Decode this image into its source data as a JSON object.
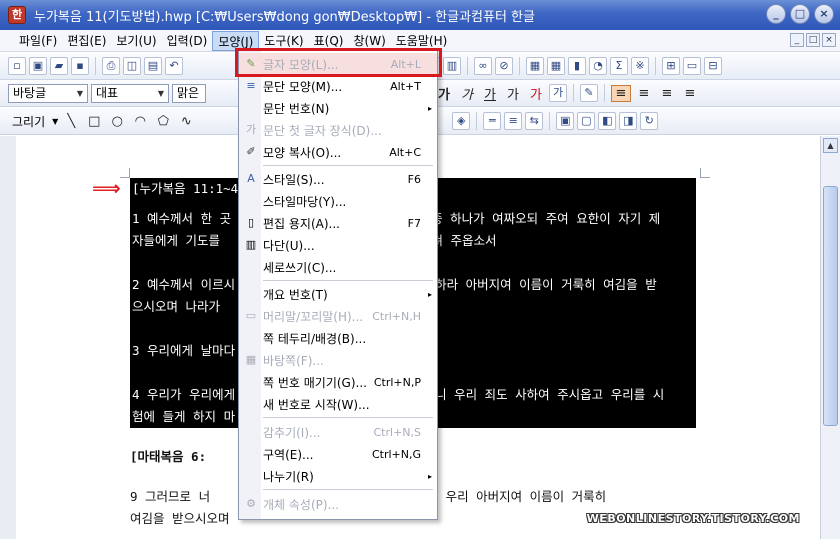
{
  "window": {
    "title": "누가복음 11(기도방법).hwp [C:₩Users₩dong gon₩Desktop₩] - 한글과컴퓨터 한글",
    "app_icon": "hwp-app-icon",
    "controls": [
      "_",
      "□",
      "×"
    ]
  },
  "menubar": {
    "items": [
      "파일(F)",
      "편집(E)",
      "보기(U)",
      "입력(D)",
      "모양(J)",
      "도구(K)",
      "표(Q)",
      "창(W)",
      "도움말(H)"
    ],
    "active": "모양(J)"
  },
  "toolbar2": {
    "font_style": "바탕글",
    "font_rep": "대표",
    "font_name": "맑은",
    "format_buttons": [
      "가",
      "가",
      "가",
      "가",
      "가"
    ]
  },
  "toolbar3": {
    "draw_label": "그리기"
  },
  "dropdown": {
    "items": [
      {
        "label": "글자 모양(L)...",
        "shortcut": "Alt+L",
        "icon": "char-shape-icon",
        "disabled": true,
        "highlight": true
      },
      {
        "label": "문단 모양(M)...",
        "shortcut": "Alt+T",
        "icon": "para-shape-icon",
        "disabled": false
      },
      {
        "label": "문단 번호(N)",
        "shortcut": "",
        "icon": "",
        "disabled": false,
        "submenu": true
      },
      {
        "label": "문단 첫 글자 장식(D)...",
        "shortcut": "",
        "icon": "drop-cap-icon",
        "disabled": true
      },
      {
        "label": "모양 복사(O)...",
        "shortcut": "Alt+C",
        "icon": "format-copy-icon",
        "disabled": false
      },
      {
        "label": "스타일(S)...",
        "shortcut": "F6",
        "icon": "style-icon",
        "disabled": false
      },
      {
        "label": "스타일마당(Y)...",
        "shortcut": "",
        "icon": "",
        "disabled": false
      },
      {
        "label": "편집 용지(A)...",
        "shortcut": "F7",
        "icon": "page-setup-icon",
        "disabled": false
      },
      {
        "label": "다단(U)...",
        "shortcut": "",
        "icon": "columns-icon",
        "disabled": false
      },
      {
        "label": "세로쓰기(C)...",
        "shortcut": "",
        "icon": "",
        "disabled": false
      },
      {
        "label": "개요 번호(T)",
        "shortcut": "",
        "icon": "",
        "disabled": false,
        "submenu": true
      },
      {
        "label": "머리말/꼬리말(H)...",
        "shortcut": "Ctrl+N,H",
        "icon": "header-footer-icon",
        "disabled": true
      },
      {
        "label": "쪽 테두리/배경(B)...",
        "shortcut": "",
        "icon": "",
        "disabled": false
      },
      {
        "label": "바탕쪽(F)...",
        "shortcut": "",
        "icon": "master-page-icon",
        "disabled": true
      },
      {
        "label": "쪽 번호 매기기(G)...",
        "shortcut": "Ctrl+N,P",
        "icon": "",
        "disabled": false
      },
      {
        "label": "새 번호로 시작(W)...",
        "shortcut": "",
        "icon": "",
        "disabled": false
      },
      {
        "label": "감추기(I)...",
        "shortcut": "Ctrl+N,S",
        "icon": "",
        "disabled": true
      },
      {
        "label": "구역(E)...",
        "shortcut": "Ctrl+N,G",
        "icon": "",
        "disabled": false
      },
      {
        "label": "나누기(R)",
        "shortcut": "",
        "icon": "",
        "disabled": false,
        "submenu": true
      },
      {
        "label": "개체 속성(P)...",
        "shortcut": "",
        "icon": "object-props-icon",
        "disabled": true
      }
    ]
  },
  "document": {
    "heading1": "[누가복음 11:1~4]",
    "lines": [
      "1 예수께서 한 곳",
      "자들에게 기도를",
      "중 하나가 여짜오되 주여 요한이 자기 제",
      "르쳐 주옵소서",
      "2 예수께서 이르시",
      "으시오며 나라가",
      "하라 아버지여 이름이 거룩히 여김을 받",
      "3 우리에게 날마다",
      "4 우리가 우리에게",
      "험에 들게 하지 마",
      "니 우리 죄도 사하여 주시옵고 우리를 시"
    ],
    "heading2": "[마태복음 6:",
    "line9_left": "9 그러므로 너",
    "line9_right": "계신 우리 아버지여 이름이 거룩히",
    "line10": "여김을 받으시오며"
  },
  "watermark": "WEBONLINESTORY.TISTORY.COM",
  "colors": {
    "highlight_border": "#d7191f",
    "arrow": "#e02020",
    "titlebar": "#3e66c4"
  }
}
